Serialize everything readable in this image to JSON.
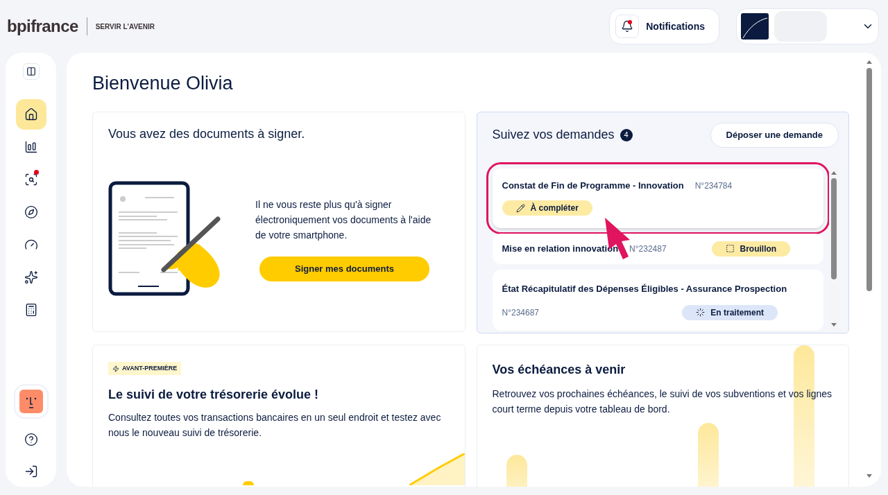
{
  "header": {
    "logo": "bpifrance",
    "tagline": "SERVIR L'AVENIR",
    "notifications": {
      "label": "Notifications",
      "unread": true
    }
  },
  "sidebar": {
    "items": [
      {
        "kind": "home",
        "selected": true,
        "badge": false
      },
      {
        "kind": "stats",
        "selected": false,
        "badge": false
      },
      {
        "kind": "analytics",
        "selected": false,
        "badge": true
      },
      {
        "kind": "compass",
        "selected": false,
        "badge": false
      },
      {
        "kind": "gauge",
        "selected": false,
        "badge": false
      },
      {
        "kind": "sparkles",
        "selected": false,
        "badge": false
      },
      {
        "kind": "calculator",
        "selected": false,
        "badge": false
      }
    ]
  },
  "greeting": "Bienvenue Olivia",
  "sign_card": {
    "title": "Vous avez des documents à signer.",
    "text": "Il ne vous reste plus qu'à signer électroniquement vos documents à l'aide de votre smartphone.",
    "button": "Signer mes documents"
  },
  "requests": {
    "title": "Suivez vos demandes",
    "count": "4",
    "button": "Déposer une demande",
    "items": [
      {
        "title": "Constat de Fin de Programme - Innovation",
        "number": "N°234784",
        "status": {
          "label": "À compléter",
          "kind": "to-complete"
        },
        "kind": "badge-below",
        "highlighted": true
      },
      {
        "title": "Mise en relation innovation",
        "number": "N°232487",
        "status": {
          "label": "Brouillon",
          "kind": "draft"
        },
        "kind": "single-row",
        "highlighted": false
      },
      {
        "title": "État Récapitulatif des Dépenses Éligibles - Assurance Prospection",
        "number": "N°234687",
        "status": {
          "label": "En traitement",
          "kind": "processing"
        },
        "kind": "number-below",
        "highlighted": false
      }
    ]
  },
  "treasury_card": {
    "tag": "AVANT-PREMIÈRE",
    "title": "Le suivi de votre trésorerie évolue !",
    "text": "Consultez toutes vos transactions bancaires en un seul endroit et testez avec nous le nouveau suivi de trésorerie."
  },
  "deadlines_card": {
    "title": "Vos échéances à venir",
    "text": "Retrouvez vos prochaines échéances, le suivi de vos subventions et vos lignes court terme depuis votre tableau de bord."
  }
}
